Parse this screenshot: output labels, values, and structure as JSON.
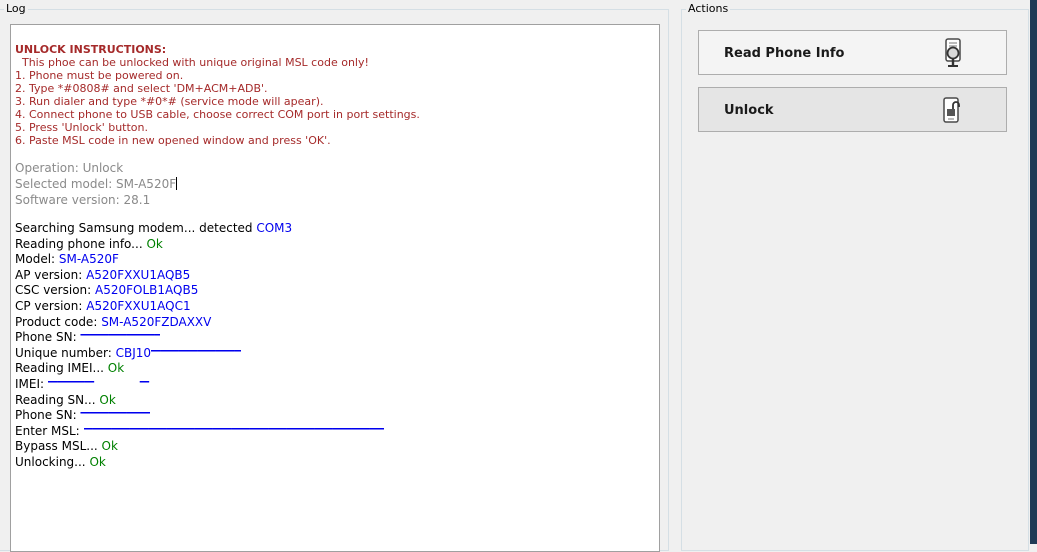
{
  "log_group": {
    "caption": "Log"
  },
  "actions_group": {
    "caption": "Actions"
  },
  "instructions": {
    "title": "UNLOCK INSTRUCTIONS:",
    "lines": [
      "  This phoe can be unlocked with unique original MSL code only!",
      "1. Phone must be powered on.",
      "2. Type *#0808# and select 'DM+ACM+ADB'.",
      "3. Run dialer and type *#0*# (service mode will apear).",
      "4. Connect phone to USB cable, choose correct COM port in port settings.",
      "5. Press 'Unlock' button.",
      "6. Paste MSL code in new opened window and press 'OK'."
    ]
  },
  "operation": {
    "operation_line": "Operation: Unlock",
    "model_line": "Selected model: SM-A520F",
    "software_line": "Software version: 28.1"
  },
  "log": {
    "searching_label": "Searching Samsung modem... detected ",
    "searching_value": "COM3",
    "reading_info_label": "Reading phone info... ",
    "reading_info_value": "Ok",
    "model_label": "Model: ",
    "model_value": "SM-A520F",
    "ap_label": "AP version: ",
    "ap_value": "A520FXXU1AQB5",
    "csc_label": "CSC version: ",
    "csc_value": "A520FOLB1AQB5",
    "cp_label": "CP version: ",
    "cp_value": "A520FXXU1AQC1",
    "product_label": "Product code: ",
    "product_value": "SM-A520FZDAXXV",
    "phone_sn_label": "Phone SN: ",
    "unique_label": "Unique number: ",
    "unique_value": "CBJ10",
    "reading_imei_label": "Reading IMEI... ",
    "reading_imei_value": "Ok",
    "imei_label": "IMEI: ",
    "reading_sn_label": "Reading SN... ",
    "reading_sn_value": "Ok",
    "phone_sn2_label": "Phone SN: ",
    "msl_label": "Enter MSL: ",
    "bypass_label": "Bypass MSL... ",
    "bypass_value": "Ok",
    "unlocking_label": "Unlocking... ",
    "unlocking_value": "Ok"
  },
  "actions": {
    "read_info_label": "Read Phone Info",
    "read_info_icon": "magnifier-phone-icon",
    "unlock_label": "Unlock",
    "unlock_icon": "unlock-phone-icon"
  }
}
